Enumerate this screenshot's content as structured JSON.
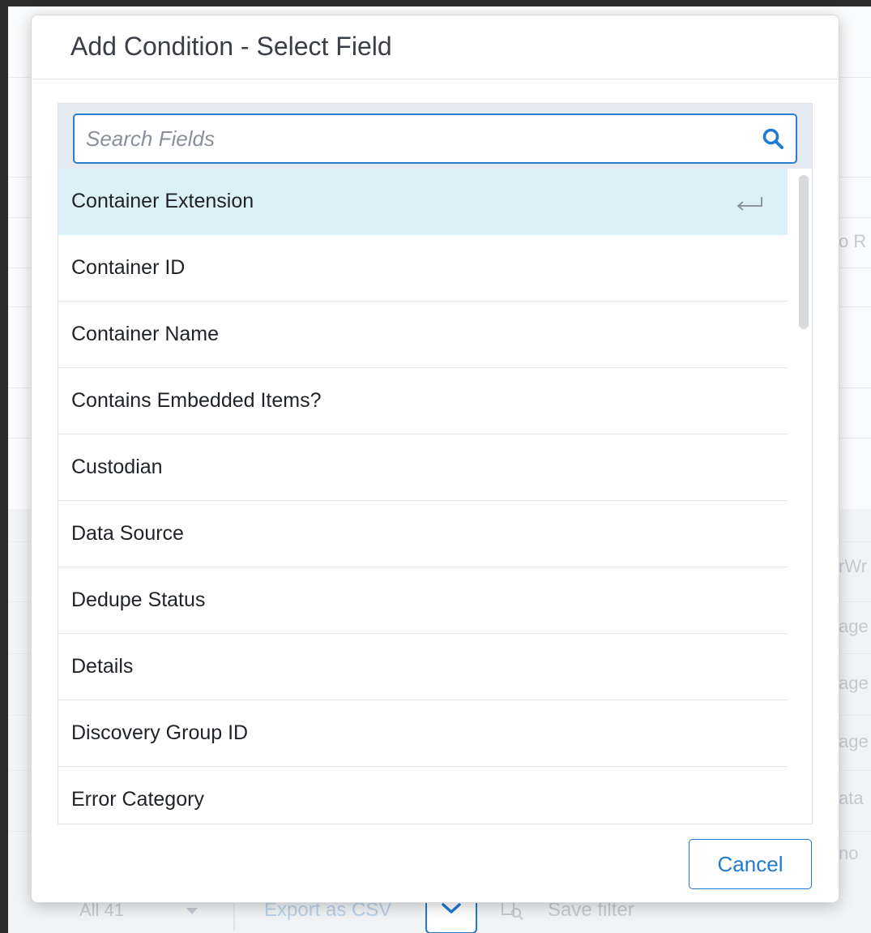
{
  "modal": {
    "title": "Add Condition - Select Field",
    "search": {
      "placeholder": "Search Fields",
      "value": ""
    },
    "fields": [
      {
        "label": "Container Extension",
        "active": true
      },
      {
        "label": "Container ID"
      },
      {
        "label": "Container Name"
      },
      {
        "label": "Contains Embedded Items?"
      },
      {
        "label": "Custodian"
      },
      {
        "label": "Data Source"
      },
      {
        "label": "Dedupe Status"
      },
      {
        "label": "Details"
      },
      {
        "label": "Discovery Group ID"
      },
      {
        "label": "Error Category"
      }
    ],
    "cancel_label": "Cancel"
  },
  "background": {
    "side_fragments": [
      "o R",
      "rWr",
      "age",
      "age",
      "age",
      "ata",
      "no"
    ],
    "footer": {
      "select_label": "All 41",
      "export_label": "Export as CSV",
      "save_filter_label": "Save filter"
    }
  },
  "icons": {
    "search": "search-icon",
    "enter": "enter-key-icon",
    "chevron": "chevron-down-icon",
    "save_filter": "save-filter-icon"
  },
  "colors": {
    "accent": "#1f7ad1",
    "active_row": "#dcf0f8",
    "search_wrap": "#e5ebf1"
  }
}
